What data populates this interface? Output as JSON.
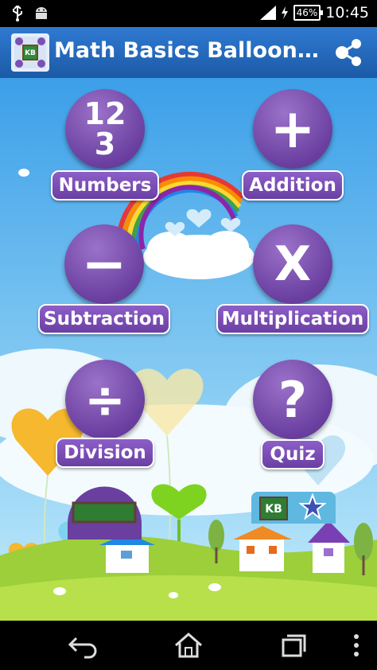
{
  "status_bar": {
    "time": "10:45",
    "battery": "46%"
  },
  "app_bar": {
    "title": "Math Basics Balloon…"
  },
  "menu": {
    "numbers": {
      "label": "Numbers",
      "glyph_top": "12",
      "glyph_bottom": "3"
    },
    "addition": {
      "label": "Addition",
      "glyph": "+"
    },
    "subtraction": {
      "label": "Subtraction",
      "glyph": "−"
    },
    "multiplication": {
      "label": "Multiplication",
      "glyph": "X"
    },
    "division": {
      "label": "Division",
      "glyph": "÷"
    },
    "quiz": {
      "label": "Quiz",
      "glyph": "?"
    }
  },
  "promo": {
    "kb_label": "KB"
  },
  "icons": [
    "usb-icon",
    "android-icon",
    "signal-icon",
    "battery-icon",
    "share-icon",
    "back-icon",
    "home-icon",
    "recent-apps-icon",
    "overflow-menu-icon"
  ],
  "colors": {
    "action_bar": "#2f7ad2",
    "button_purple": "#6a3fa0",
    "grass": "#9ccf3a",
    "sky": "#3c9fe8"
  }
}
